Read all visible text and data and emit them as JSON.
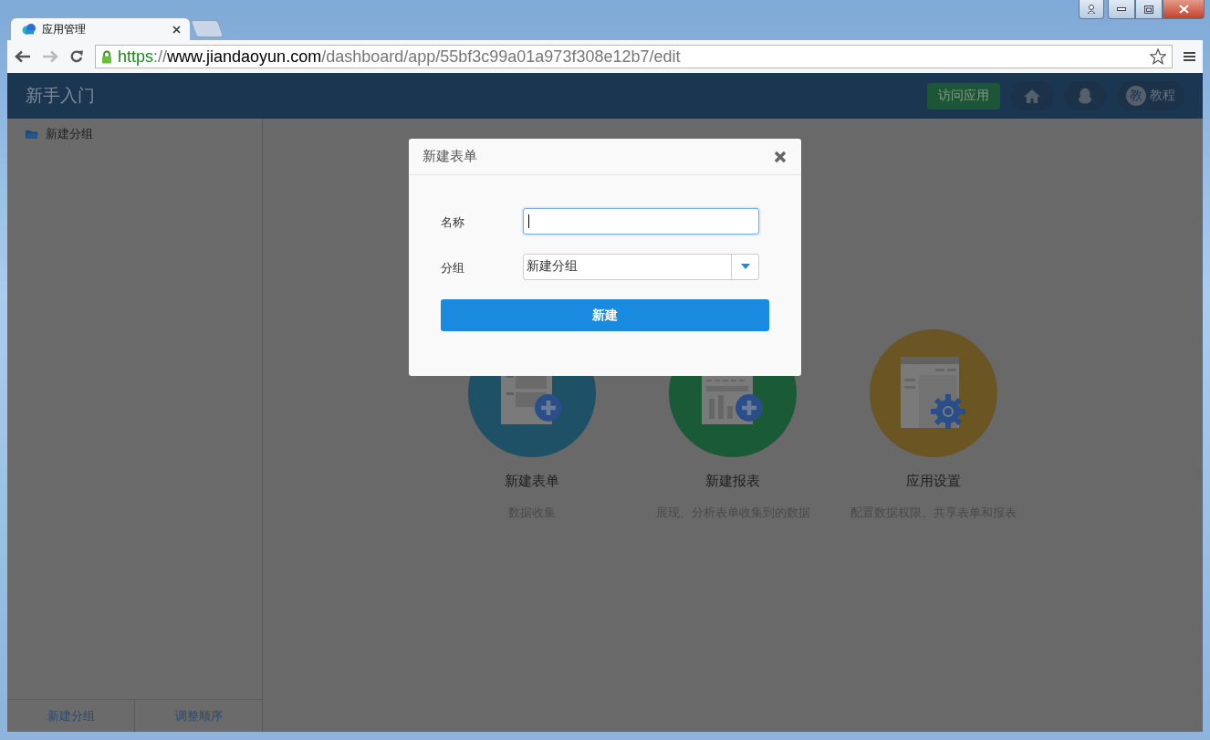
{
  "browser": {
    "tabs": [
      {
        "title": "应用管理",
        "selected": true
      }
    ],
    "url": [
      {
        "kind": "scheme",
        "text": "https"
      },
      {
        "kind": "sep",
        "text": "://"
      },
      {
        "kind": "host",
        "text": "www.jiandaoyun.com"
      },
      {
        "kind": "path",
        "text": "/dashboard/app/55bf3c99a01a973f308e12b7/edit"
      }
    ]
  },
  "header": {
    "title": "新手入门",
    "visit_button": "访问应用",
    "tutorial_badge": "教",
    "tutorial_label": "教程"
  },
  "sidebar": {
    "groups": [
      {
        "label": "新建分组"
      }
    ],
    "footer_buttons": [
      "新建分组",
      "调整顺序"
    ]
  },
  "cards": [
    {
      "kind": "form",
      "title": "新建表单",
      "description": "数据收集",
      "color": "#1e5066"
    },
    {
      "kind": "report",
      "title": "新建报表",
      "description": "展现、分析表单收集到的数据",
      "color": "#1a5a36"
    },
    {
      "kind": "settings",
      "title": "应用设置",
      "description": "配置数据权限、共享表单和报表",
      "color": "#6b5522"
    }
  ],
  "dialog": {
    "title": "新建表单",
    "fields": [
      {
        "kind": "text",
        "label": "名称",
        "focused": true
      },
      {
        "kind": "select",
        "label": "分组",
        "value": "新建分组",
        "focused": false
      }
    ],
    "submit": "新建"
  }
}
